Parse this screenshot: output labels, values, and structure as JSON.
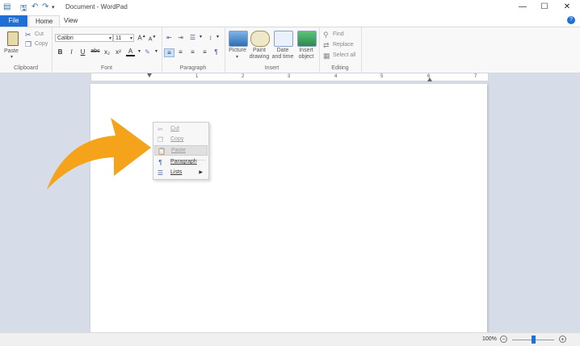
{
  "window": {
    "title": "Document - WordPad",
    "quick_access": [
      "save-icon",
      "undo-icon",
      "redo-icon",
      "customize-icon"
    ]
  },
  "tabs": [
    "File",
    "Home",
    "View"
  ],
  "ribbon": {
    "clipboard": {
      "paste": "Paste",
      "cut": "Cut",
      "copy": "Copy",
      "group_label": "Clipboard"
    },
    "font": {
      "family": "Calibri",
      "size": "11",
      "group_label": "Font",
      "bold": "B",
      "italic": "I",
      "underline": "U",
      "strike": "abc",
      "subscript": "x₂",
      "superscript": "x²",
      "color": "A"
    },
    "paragraph": {
      "group_label": "Paragraph"
    },
    "insert": {
      "picture": "Picture",
      "paint_drawing": "Paint drawing",
      "date_time": "Date and time",
      "insert_object": "Insert object",
      "group_label": "Insert"
    },
    "editing": {
      "find": "Find",
      "replace": "Replace",
      "select_all": "Select all",
      "group_label": "Editing"
    }
  },
  "ruler": {
    "labels": [
      "1",
      "2",
      "3",
      "4",
      "5",
      "6",
      "7"
    ]
  },
  "context_menu": {
    "items": [
      {
        "label": "Cut",
        "state": "disabled",
        "icon": "scissors-icon"
      },
      {
        "label": "Copy",
        "state": "disabled",
        "icon": "copy-icon"
      },
      {
        "label": "Paste",
        "state": "highlighted",
        "icon": "clipboard-icon"
      },
      {
        "label": "Paragraph",
        "state": "normal",
        "icon": "paragraph-icon"
      },
      {
        "label": "Lists",
        "state": "normal",
        "icon": "list-icon",
        "has_submenu": true
      }
    ]
  },
  "statusbar": {
    "zoom": "100%",
    "zoom_level": 0.5
  },
  "colors": {
    "accent": "#1e6fd6",
    "arrow": "#f5a31a"
  }
}
